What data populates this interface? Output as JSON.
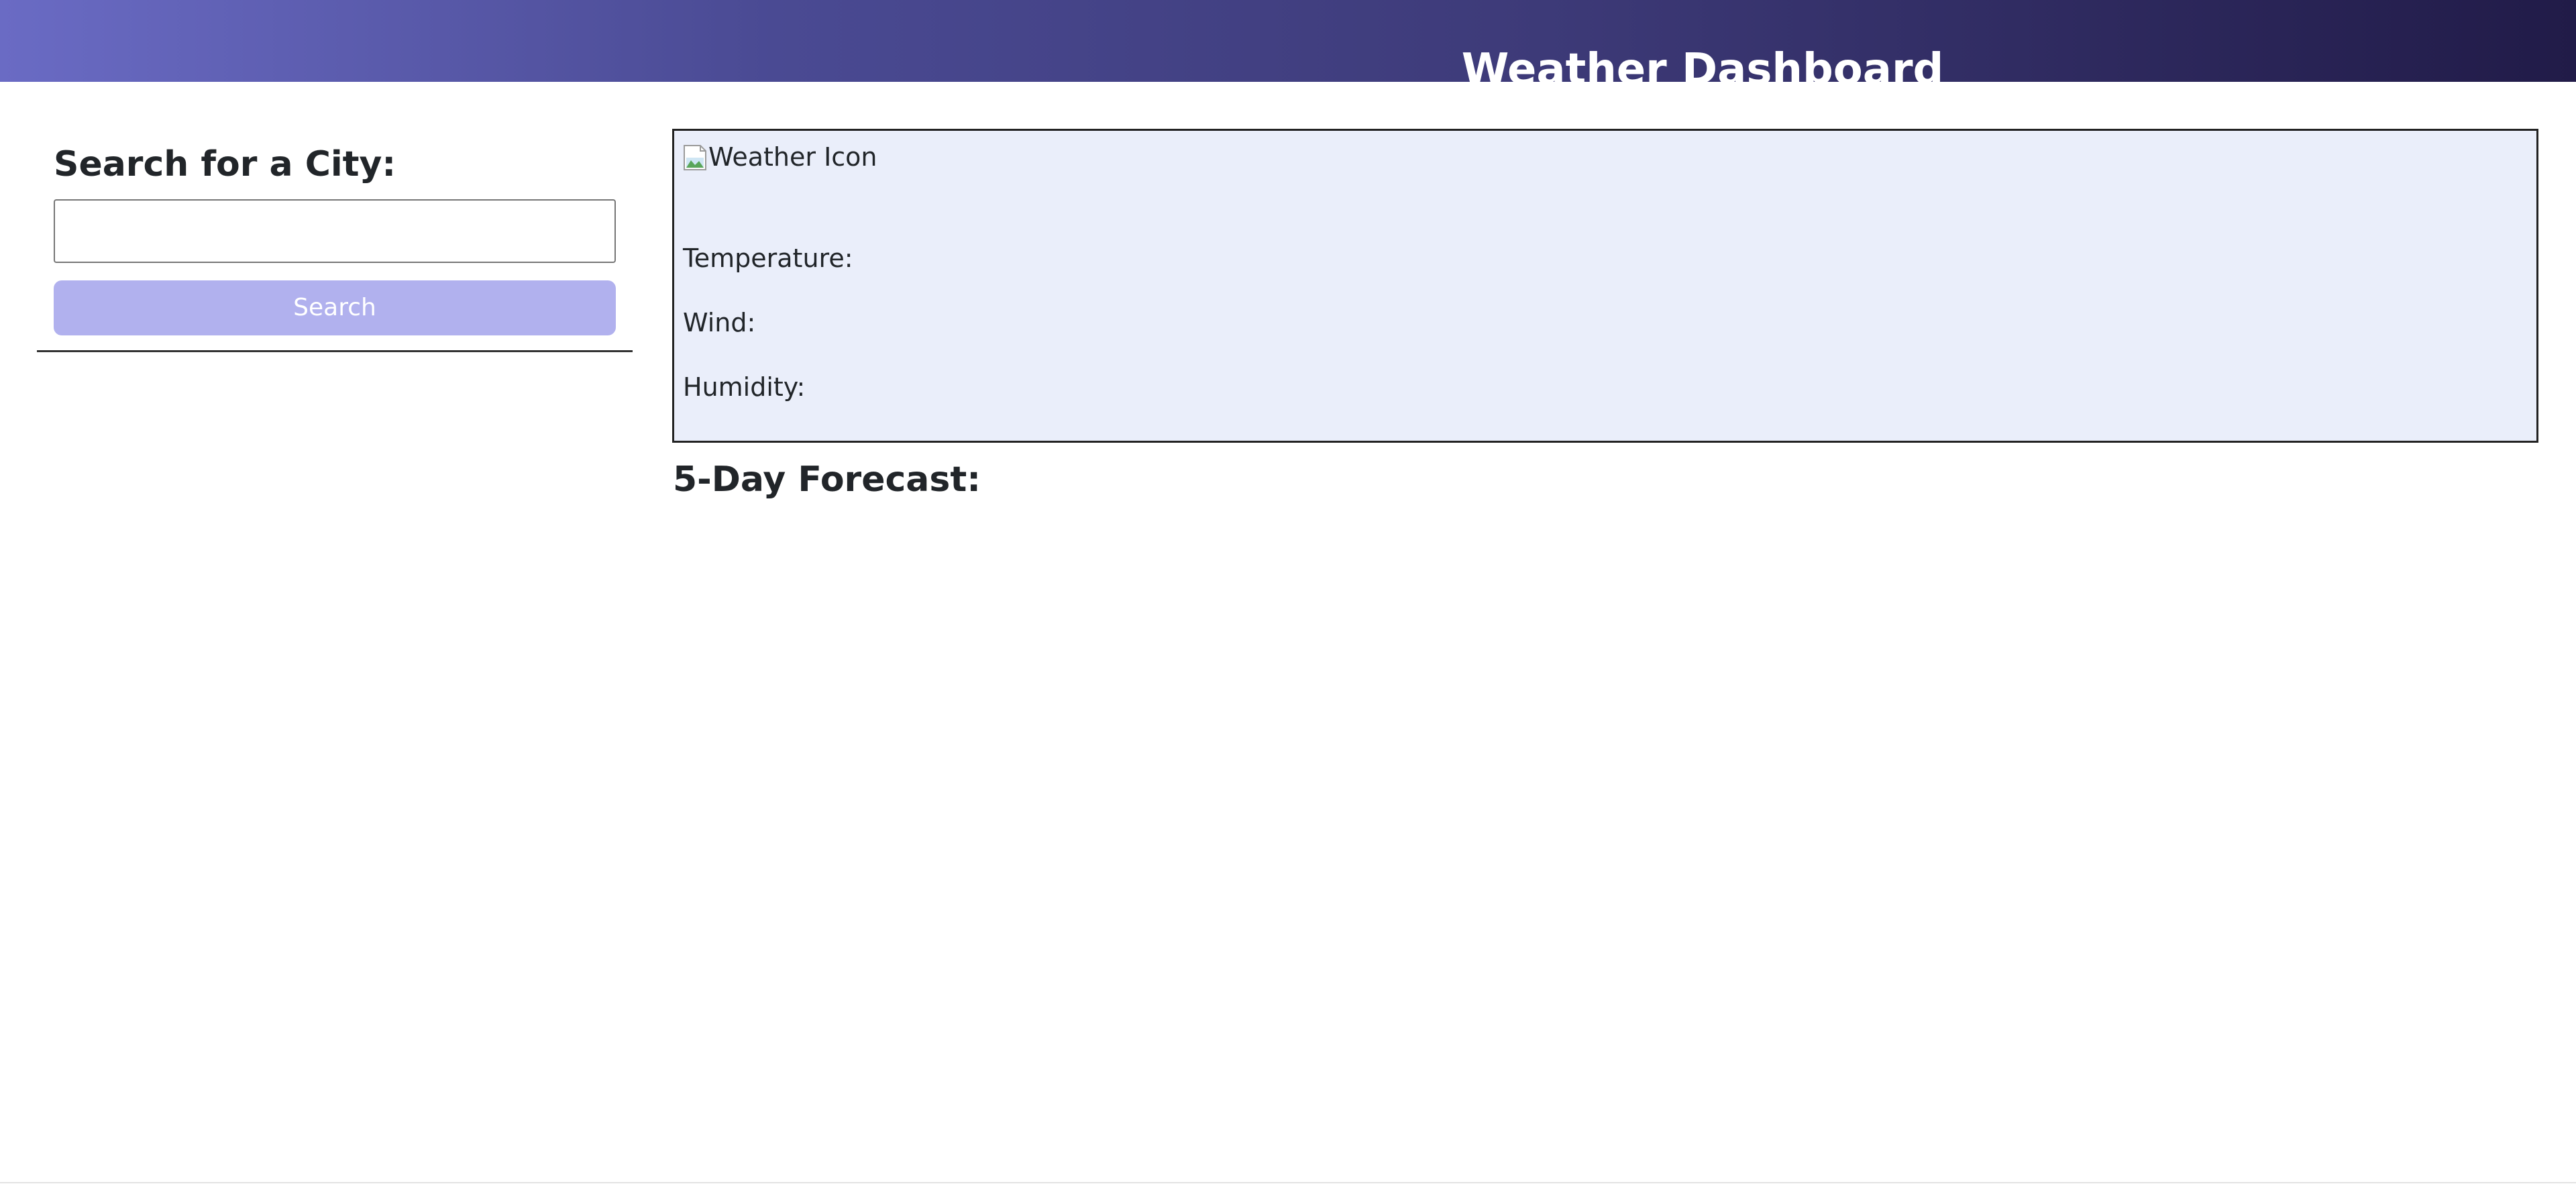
{
  "header": {
    "title": "Weather Dashboard"
  },
  "sidebar": {
    "title": "Search for a City:",
    "search_input": {
      "value": "",
      "placeholder": ""
    },
    "search_button_label": "Search"
  },
  "current_weather": {
    "icon_alt": "Weather Icon",
    "temperature_label": "Temperature:",
    "wind_label": "Wind:",
    "humidity_label": "Humidity:"
  },
  "forecast": {
    "title": "5-Day Forecast:"
  },
  "colors": {
    "header_gradient_start": "#6a6bc4",
    "header_gradient_end": "#211b48",
    "search_button": "#b1b1ee",
    "card_background": "#eaeefa"
  }
}
